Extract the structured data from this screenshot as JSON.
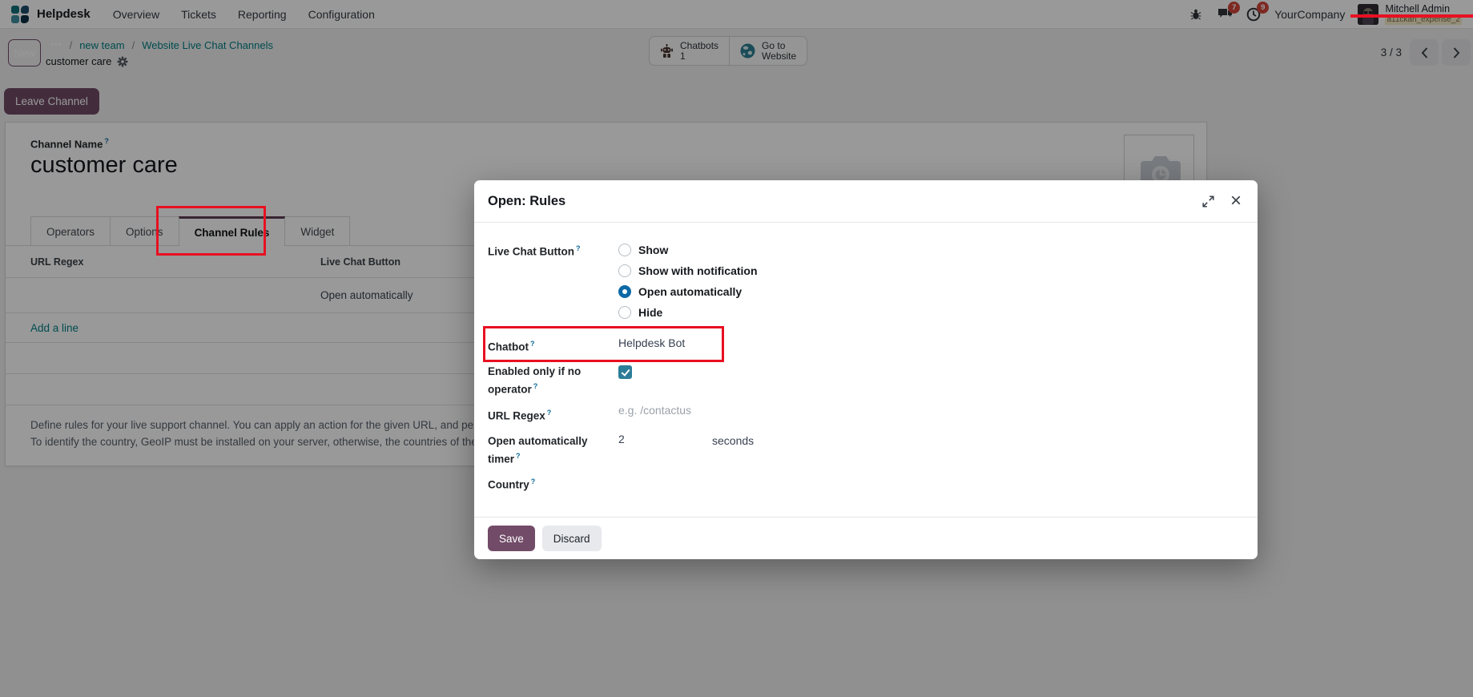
{
  "navbar": {
    "app_name": "Helpdesk",
    "menus": [
      "Overview",
      "Tickets",
      "Reporting",
      "Configuration"
    ],
    "messages_badge": "7",
    "activities_badge": "9",
    "company": "YourCompany",
    "user_name": "Mitchell Admin",
    "database_name": "a11ckan_expense_2"
  },
  "control_panel": {
    "new_button": "New",
    "breadcrumb_dots": "•••",
    "breadcrumb_separator": "/",
    "breadcrumb_parent": "new team",
    "breadcrumb_list": "Website Live Chat Channels",
    "record_name": "customer care",
    "stat_buttons": {
      "chatbots_label": "Chatbots",
      "chatbots_count": "1",
      "website_line1": "Go to",
      "website_line2": "Website"
    },
    "pager_value": "3 / 3"
  },
  "form": {
    "leave_channel_button": "Leave Channel",
    "channel_name_label": "Channel Name",
    "channel_name_value": "customer care",
    "tabs": [
      "Operators",
      "Options",
      "Channel Rules",
      "Widget"
    ],
    "active_tab": "Channel Rules",
    "rules_table": {
      "col1": "URL Regex",
      "col2": "Live Chat Button",
      "row1_live_chat_button": "Open automatically",
      "add_line": "Add a line"
    },
    "help_line1": "Define rules for your live support channel. You can apply an action for the given URL, and per country.",
    "help_line2": "To identify the country, GeoIP must be installed on your server, otherwise, the countries of the rules will not be taken into account."
  },
  "modal": {
    "title": "Open: Rules",
    "live_chat_button": {
      "label": "Live Chat Button",
      "options": [
        "Show",
        "Show with notification",
        "Open automatically",
        "Hide"
      ],
      "selected": "Open automatically"
    },
    "chatbot": {
      "label": "Chatbot",
      "value": "Helpdesk Bot"
    },
    "enabled_only": {
      "label_line1": "Enabled only if no",
      "label_line2": "operator",
      "checked": true
    },
    "url_regex": {
      "label": "URL Regex",
      "placeholder": "e.g. /contactus"
    },
    "timer": {
      "label_line1": "Open automatically",
      "label_line2": "timer",
      "value": "2",
      "unit": "seconds"
    },
    "country": {
      "label": "Country"
    },
    "save": "Save",
    "discard": "Discard"
  },
  "ui": {
    "help_marker": "?",
    "close_glyph": "×"
  },
  "colors": {
    "primary": "#714B67",
    "link_teal": "#017e84",
    "radio_blue": "#0d69a6",
    "checkbox_teal": "#2c7d98",
    "annotation_red": "#e81021",
    "badge_red": "#d0453a"
  }
}
